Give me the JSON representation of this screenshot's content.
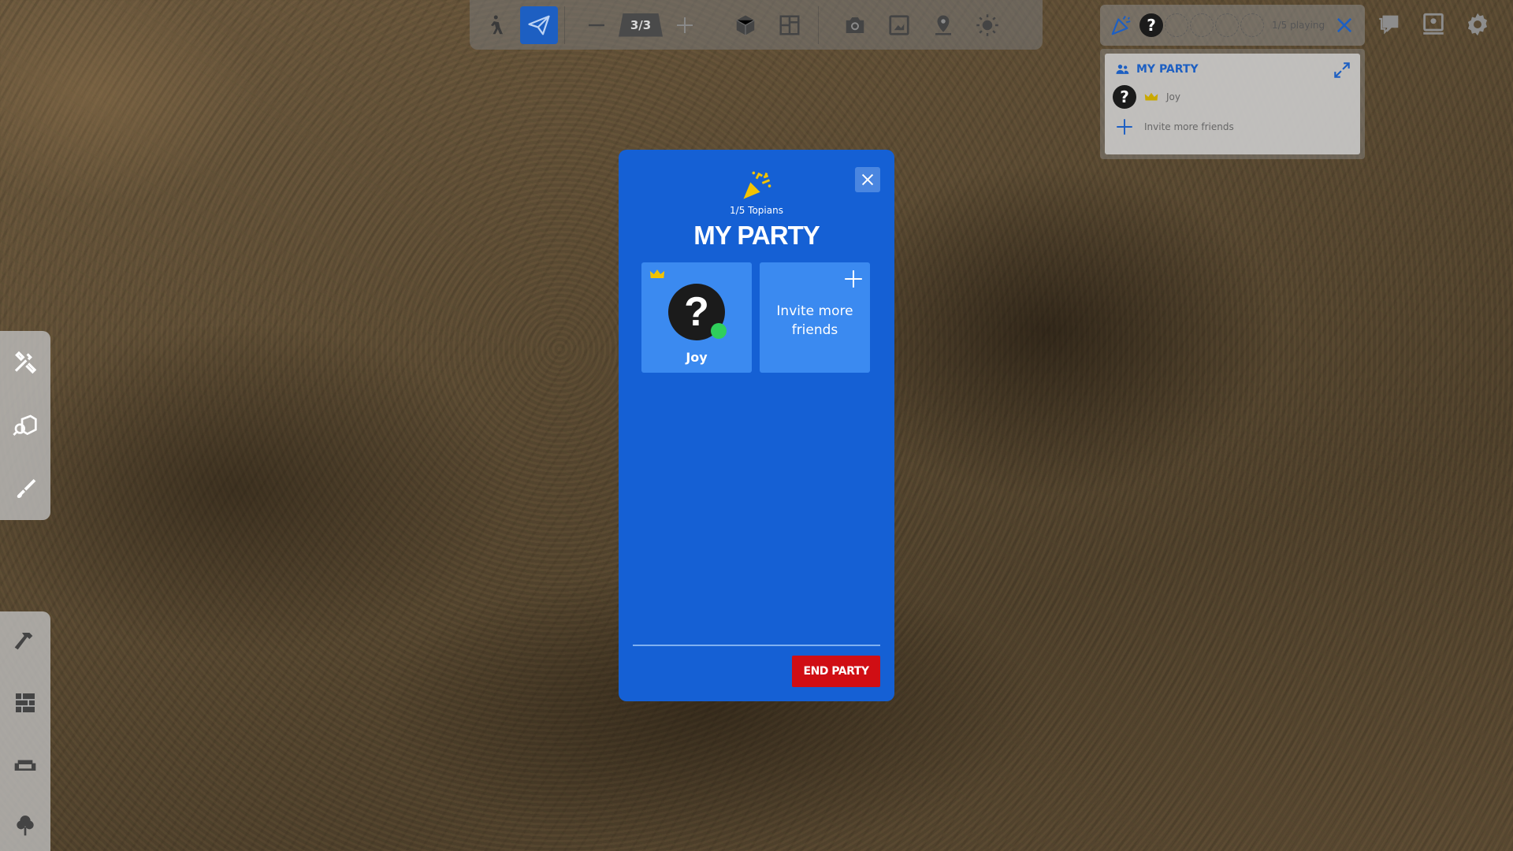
{
  "toolbar": {
    "floor_counter": "3/3",
    "icons": [
      "walk-icon",
      "fly-icon",
      "minus-icon",
      "plus-icon",
      "cube-icon",
      "floorplan-icon",
      "camera-icon",
      "screenshot-icon",
      "location-pin-icon",
      "sun-icon"
    ]
  },
  "party_bar": {
    "avatar_glyph": "?",
    "playing_text": "1/5 playing"
  },
  "mini_party": {
    "title": "MY PARTY",
    "member_name": "Joy",
    "avatar_glyph": "?",
    "invite_text": "Invite more friends"
  },
  "modal": {
    "count_text": "1/5 Topians",
    "title": "MY PARTY",
    "member": {
      "name": "Joy",
      "avatar_glyph": "?",
      "status": "online",
      "is_host": true
    },
    "invite_text": "Invite more friends",
    "end_button": "END PARTY"
  },
  "sidebar": {
    "upper": [
      "wrench-hammer-icon",
      "inventory-search-icon",
      "paint-brush-icon"
    ],
    "lower": [
      "hammer-icon",
      "wall-icon",
      "sofa-icon",
      "tree-icon"
    ]
  },
  "colors": {
    "modal_blue": "#1560d4",
    "card_blue": "#3b8af0",
    "accent_blue": "#1d5fc2",
    "end_red": "#d00e14",
    "online_green": "#2fcf5b",
    "crown_yellow": "#f2c300"
  }
}
